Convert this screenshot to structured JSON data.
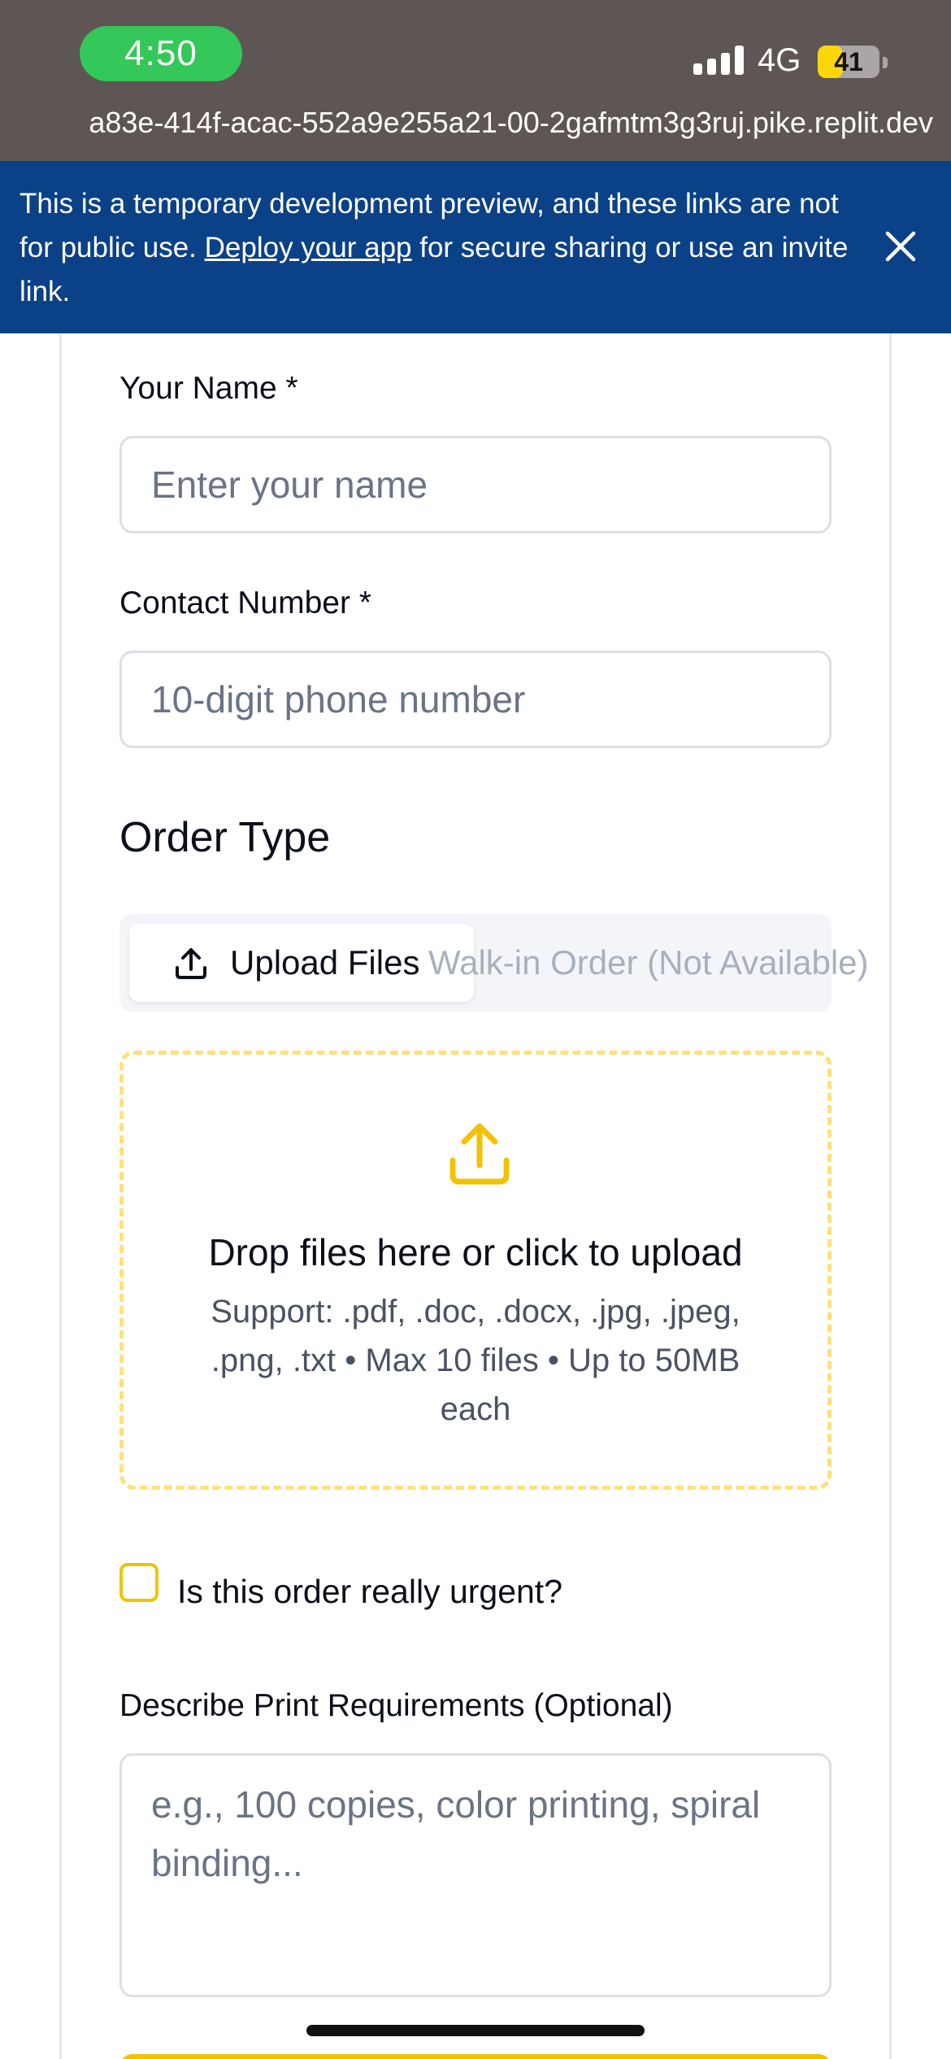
{
  "status_bar": {
    "time": "4:50",
    "network": "4G",
    "battery_level": "41",
    "battery_fraction": 0.41
  },
  "browser": {
    "url": "a83e-414f-acac-552a9e255a21-00-2gafmtm3g3ruj.pike.replit.dev"
  },
  "banner": {
    "text_before": "This is a temporary development preview, and these links are not for public use. ",
    "link": "Deploy your app",
    "text_after": " for secure sharing or use an invite link."
  },
  "form": {
    "name_label": "Your Name *",
    "name_placeholder": "Enter your name",
    "contact_label": "Contact Number *",
    "contact_placeholder": "10-digit phone number",
    "order_type_title": "Order Type",
    "tab_upload": "Upload Files",
    "tab_walkin": "Walk-in Order (Not Available)",
    "drop_title": "Drop files here or click to upload",
    "drop_subtitle": "Support: .pdf, .doc, .docx, .jpg, .jpeg, .png, .txt • Max 10 files • Up to 50MB each",
    "urgent_label": "Is this order really urgent?",
    "urgent_checked": false,
    "requirements_label": "Describe Print Requirements (Optional)",
    "requirements_placeholder": "e.g., 100 copies, color printing, spiral binding..."
  },
  "colors": {
    "banner_bg": "#0b4187",
    "accent_yellow": "#f2c200",
    "time_pill": "#34c759"
  }
}
